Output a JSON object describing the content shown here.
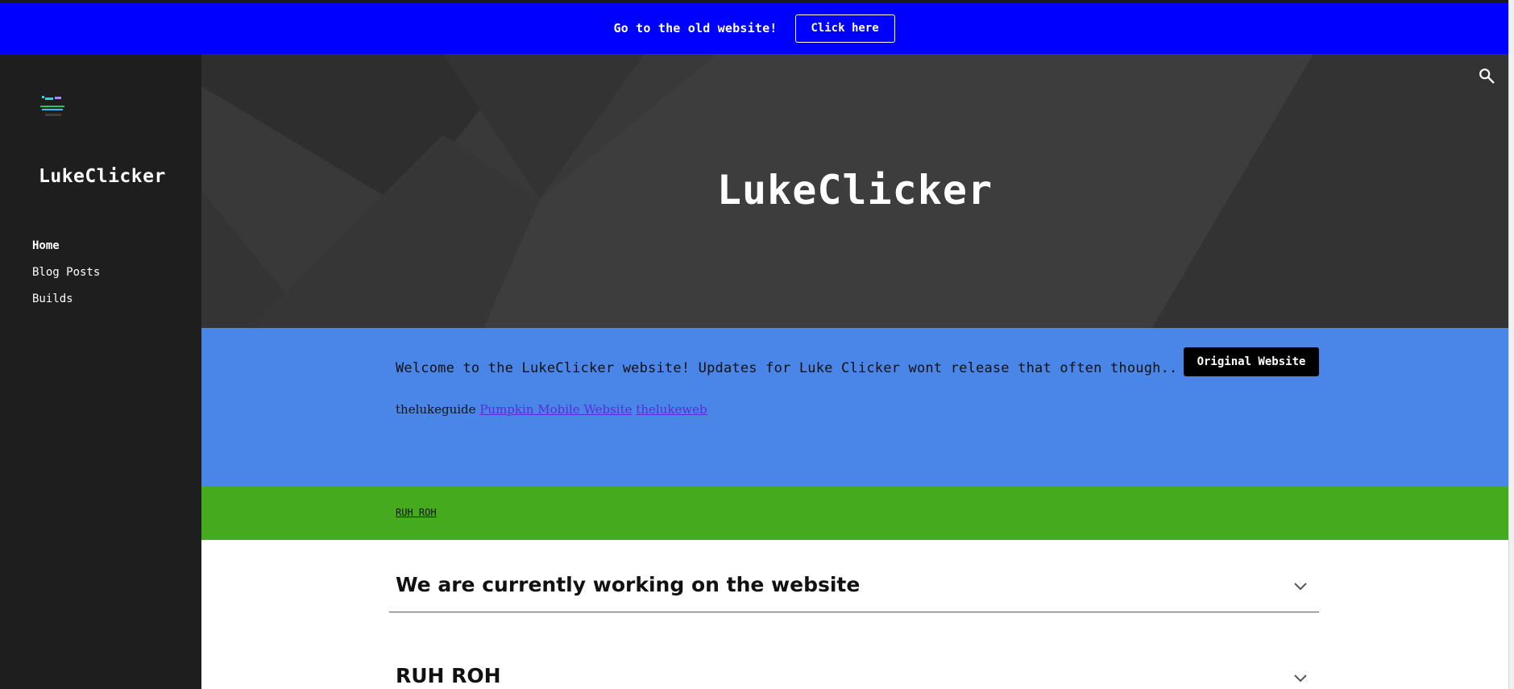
{
  "banner": {
    "text": "Go to the old website!",
    "button_label": "Click here"
  },
  "sidebar": {
    "logo_icon": "lukeclicker-logo-icon",
    "site_title": "LukeClicker",
    "nav": [
      {
        "label": "Home",
        "active": true
      },
      {
        "label": "Blog Posts",
        "active": false
      },
      {
        "label": "Builds",
        "active": false
      }
    ]
  },
  "hero": {
    "title": "LukeClicker",
    "search_icon": "search-icon"
  },
  "welcome_section": {
    "text": "Welcome to the LukeClicker website! Updates for Luke Clicker wont release that often though..",
    "prefix": "thelukeguide",
    "link1": "Pumpkin Mobile Website",
    "link2": "thelukeweb",
    "button_label": "Original Website"
  },
  "alert_section": {
    "link": "RUH ROH"
  },
  "accordions": [
    {
      "title": "We are currently working on the website"
    },
    {
      "title": "RUH ROH"
    }
  ],
  "colors": {
    "banner": "#0000ff",
    "sidebar": "#1e1e1e",
    "hero": "#3a3a3a",
    "blue_section": "#4a86e8",
    "green_section": "#46aa1f",
    "link": "#5b2bd6"
  }
}
